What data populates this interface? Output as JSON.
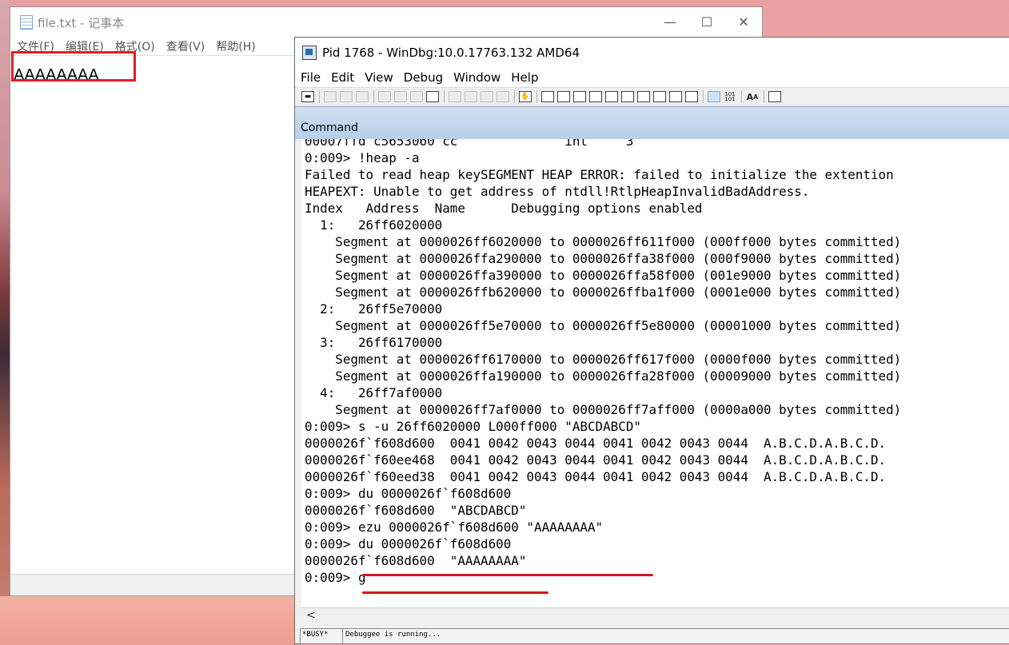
{
  "notepad": {
    "title": "file.txt - 记事本",
    "window_buttons": {
      "minimize": "—",
      "maximize": "☐",
      "close": "✕"
    },
    "menu": [
      "文件(F)",
      "编辑(E)",
      "格式(O)",
      "查看(V)",
      "帮助(H)"
    ],
    "content": "AAAAAAAA"
  },
  "windbg": {
    "title": "Pid 1768 - WinDbg:10.0.17763.132 AMD64",
    "menu": [
      "File",
      "Edit",
      "View",
      "Debug",
      "Window",
      "Help"
    ],
    "command_header": "Command",
    "output": [
      "00007ffd c5653060 cc              int     3",
      "0:009> !heap -a",
      "Failed to read heap keySEGMENT HEAP ERROR: failed to initialize the extention",
      "HEAPEXT: Unable to get address of ntdll!RtlpHeapInvalidBadAddress.",
      "Index   Address  Name      Debugging options enabled",
      "  1:   26ff6020000",
      "    Segment at 0000026ff6020000 to 0000026ff611f000 (000ff000 bytes committed)",
      "    Segment at 0000026ffa290000 to 0000026ffa38f000 (000f9000 bytes committed)",
      "    Segment at 0000026ffa390000 to 0000026ffa58f000 (001e9000 bytes committed)",
      "    Segment at 0000026ffb620000 to 0000026ffba1f000 (0001e000 bytes committed)",
      "  2:   26ff5e70000",
      "    Segment at 0000026ff5e70000 to 0000026ff5e80000 (00001000 bytes committed)",
      "  3:   26ff6170000",
      "    Segment at 0000026ff6170000 to 0000026ff617f000 (0000f000 bytes committed)",
      "    Segment at 0000026ffa190000 to 0000026ffa28f000 (00009000 bytes committed)",
      "  4:   26ff7af0000",
      "    Segment at 0000026ff7af0000 to 0000026ff7aff000 (0000a000 bytes committed)",
      "0:009> s -u 26ff6020000 L000ff000 \"ABCDABCD\"",
      "0000026f`f608d600  0041 0042 0043 0044 0041 0042 0043 0044  A.B.C.D.A.B.C.D.",
      "0000026f`f60ee468  0041 0042 0043 0044 0041 0042 0043 0044  A.B.C.D.A.B.C.D.",
      "0000026f`f60eed38  0041 0042 0043 0044 0041 0042 0043 0044  A.B.C.D.A.B.C.D.",
      "0:009> du 0000026f`f608d600",
      "0000026f`f608d600  \"ABCDABCD\"",
      "0:009> ezu 0000026f`f608d600 \"AAAAAAAA\"",
      "0:009> du 0000026f`f608d600",
      "0000026f`f608d600  \"AAAAAAAA\"",
      "0:009> g"
    ],
    "scroll_arrow": "<",
    "status_busy": "*BUSY*",
    "status_text": "Debuggee is running..."
  }
}
